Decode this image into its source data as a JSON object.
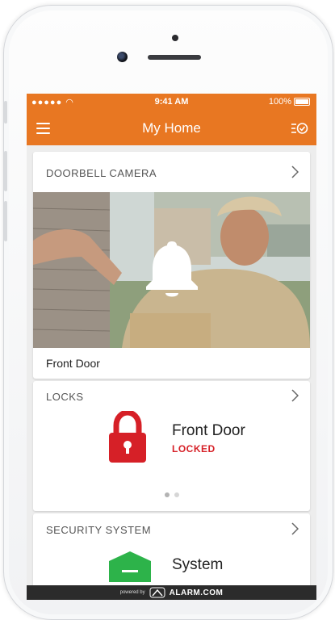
{
  "status_bar": {
    "signal": "●●●●● ",
    "time": "9:41 AM",
    "battery": "100%"
  },
  "nav": {
    "title": "My Home"
  },
  "doorbell": {
    "section_label": "DOORBELL CAMERA",
    "camera_name": "Front Door"
  },
  "locks": {
    "section_label": "LOCKS",
    "lock_name": "Front Door",
    "lock_status": "LOCKED"
  },
  "security": {
    "section_label": "SECURITY SYSTEM",
    "system_name": "System"
  },
  "footer": {
    "powered_by": "powered by",
    "brand": "ALARM.COM"
  },
  "colors": {
    "accent": "#e87722",
    "locked": "#d62027",
    "system": "#2db34a"
  }
}
